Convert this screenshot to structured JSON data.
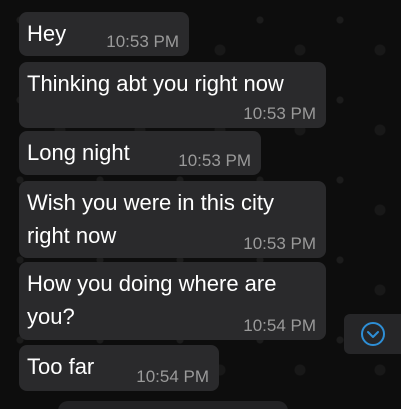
{
  "messages": [
    {
      "text": "Hey",
      "time": "10:53 PM"
    },
    {
      "text": "Thinking abt you right now",
      "time": "10:53 PM"
    },
    {
      "text": "Long night",
      "time": "10:53 PM"
    },
    {
      "text": "Wish you were in this city\nright now",
      "time": "10:53 PM"
    },
    {
      "text": "How you doing where are\nyou?",
      "time": "10:54 PM"
    },
    {
      "text": "Too far",
      "time": "10:54 PM"
    }
  ],
  "scroll_button": {
    "icon": "chevron-down-icon",
    "color": "#2e8fd6"
  },
  "colors": {
    "background": "#0d0d0d",
    "bubble": "#2a2a2c",
    "text": "#ffffff",
    "timestamp": "#9a9a9a"
  }
}
